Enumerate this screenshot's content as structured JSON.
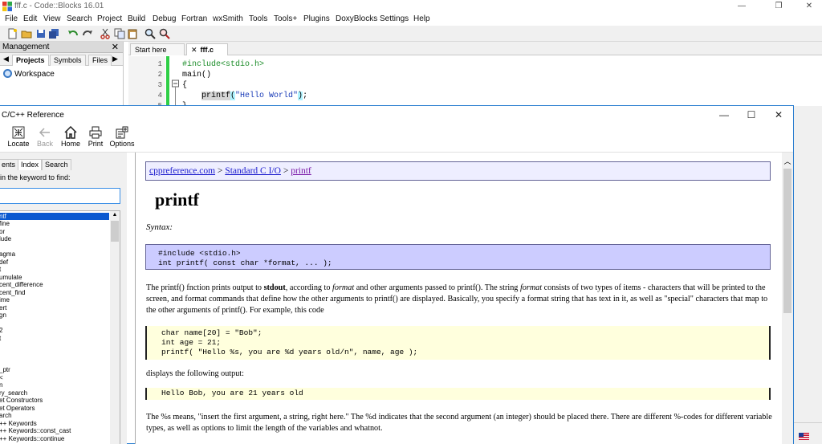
{
  "codeblocks": {
    "title": "fff.c - Code::Blocks 16.01",
    "menu": [
      "File",
      "Edit",
      "View",
      "Search",
      "Project",
      "Build",
      "Debug",
      "Fortran",
      "wxSmith",
      "Tools",
      "Tools+",
      "Plugins",
      "DoxyBlocks",
      "Settings",
      "Help"
    ],
    "management": {
      "title": "Management",
      "close": "✕",
      "tabs": [
        "Projects",
        "Symbols",
        "Files"
      ],
      "workspace": "Workspace"
    },
    "editor": {
      "tabs": [
        "Start here",
        "fff.c"
      ],
      "tab_close": "✕",
      "line_numbers": [
        "1",
        "2",
        "3",
        "4",
        "5"
      ],
      "code": {
        "line1": "#include<stdio.h>",
        "line2": "main()",
        "line3": "{",
        "line4_fn": "printf",
        "line4_open": "(",
        "line4_str": "\"Hello World\"",
        "line4_close": ")",
        "line4_end": ";",
        "line5": "}"
      }
    }
  },
  "reference": {
    "title": "C/C++ Reference",
    "toolbar": [
      {
        "label": "Locate",
        "icon": "locate-icon",
        "enabled": true
      },
      {
        "label": "Back",
        "icon": "back-arrow-icon",
        "enabled": false
      },
      {
        "label": "Home",
        "icon": "home-icon",
        "enabled": true
      },
      {
        "label": "Print",
        "icon": "printer-icon",
        "enabled": true
      },
      {
        "label": "Options",
        "icon": "options-icon",
        "enabled": true
      }
    ],
    "left": {
      "tabs": [
        "ents",
        "Index",
        "Search"
      ],
      "prompt": "in the keyword to find:",
      "search_value": "",
      "list": [
        "ntf",
        "fine",
        "or",
        "lude",
        "",
        "agma",
        "def",
        "t",
        "umulate",
        "cent_difference",
        "cent_find",
        "ime",
        "ert",
        "gn",
        "",
        "2",
        "t",
        "",
        "",
        "_ptr",
        "<",
        "n",
        "ry_search",
        "et Constructors",
        "et Operators",
        "arch",
        "++ Keywords",
        "++ Keywords::const_cast",
        "++ Keywords::continue"
      ]
    },
    "content": {
      "breadcrumb": {
        "part1": "cppreference.com",
        "sep1": " > ",
        "part2": "Standard C I/O",
        "sep2": " > ",
        "part3": "printf"
      },
      "page_title": "printf",
      "syntax_label": "Syntax:",
      "syntax_code": "#include <stdio.h>\nint printf( const char *format, ... );",
      "para1": {
        "a": "The printf() fnction prints output to ",
        "b": "stdout",
        "c": ", according to ",
        "d": "format",
        "e": " and other arguments passed to printf(). The string ",
        "f": "format",
        "g": " consists of two types of items - characters that will be printed to the screen, and format commands that define how the other arguments to printf() are displayed. Basically, you specify a format string that has text in it, as well as \"special\" characters that map to the other arguments of printf(). For example, this code"
      },
      "example_code": "char name[20] = \"Bob\";\nint age = 21;\nprintf( \"Hello %s, you are %d years old/n\", name, age );",
      "para2": "displays the following output:",
      "output_code": "Hello Bob, you are 21 years old",
      "para3": "The %s means, \"insert the first argument, a string, right here.\" The %d indicates that the second argument (an integer) should be placed there. There are different %-codes for different variable types, as well as options to limit the length of the variables and whatnot."
    }
  }
}
